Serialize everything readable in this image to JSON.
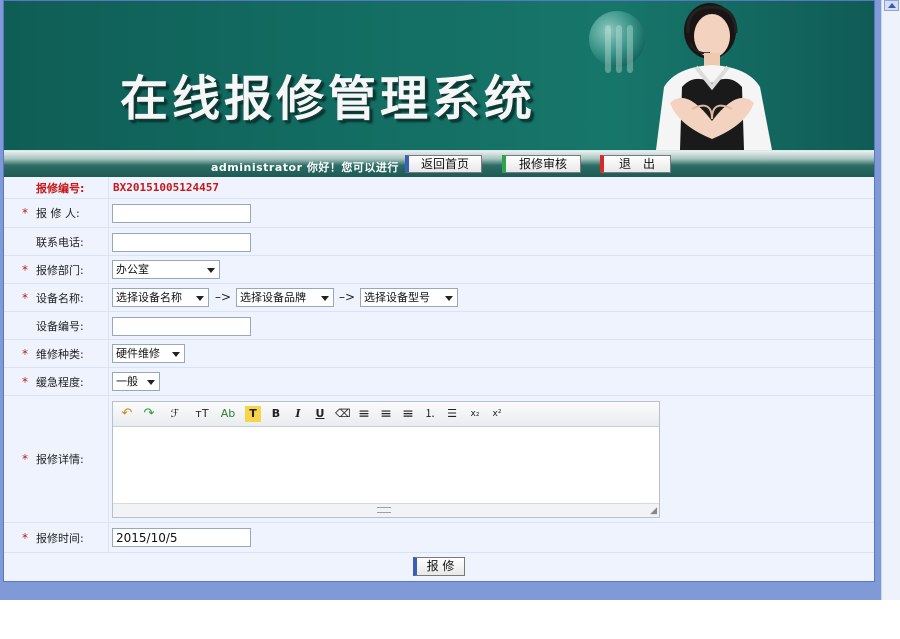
{
  "banner": {
    "title": "在线报修管理系统"
  },
  "nav": {
    "greeting": "administrator 你好！您可以进行",
    "home_label": "返回首页",
    "audit_label": "报修审核",
    "exit_label": "退　出"
  },
  "form": {
    "code_label": "报修编号:",
    "code_value": "BX20151005124457",
    "reporter_label": "报 修 人:",
    "reporter_value": "",
    "phone_label": "联系电话:",
    "phone_value": "",
    "dept_label": "报修部门:",
    "dept_value": "办公室",
    "device_label": "设备名称:",
    "device_name_value": "选择设备名称",
    "device_brand_value": "选择设备品牌",
    "device_model_value": "选择设备型号",
    "arrow": "–>",
    "device_no_label": "设备编号:",
    "device_no_value": "",
    "repair_type_label": "维修种类:",
    "repair_type_value": "硬件维修",
    "urgency_label": "缓急程度:",
    "urgency_value": "一般",
    "detail_label": "报修详情:",
    "time_label": "报修时间:",
    "time_value": "2015/10/5",
    "required_mark": "*"
  },
  "editor": {
    "toolbar": {
      "undo": "↶",
      "redo": "↷",
      "font": "ℱ",
      "fontsize": "тT",
      "font_color": "Ab",
      "highlight": "T",
      "bold": "B",
      "italic": "I",
      "underline": "U",
      "eraser": "⌫",
      "align_left": "≡",
      "align_center": "≡",
      "align_right": "≡",
      "ordered_list": "⒈",
      "unordered_list": "☰",
      "subscript": "x₂",
      "superscript": "x²"
    },
    "resize_glyph": "◢"
  },
  "submit": {
    "label": "报 修"
  },
  "colors": {
    "banner": "#136d62",
    "required": "#c81818",
    "row_bg": "#eef3fd",
    "frame": "#7f9ad6"
  }
}
